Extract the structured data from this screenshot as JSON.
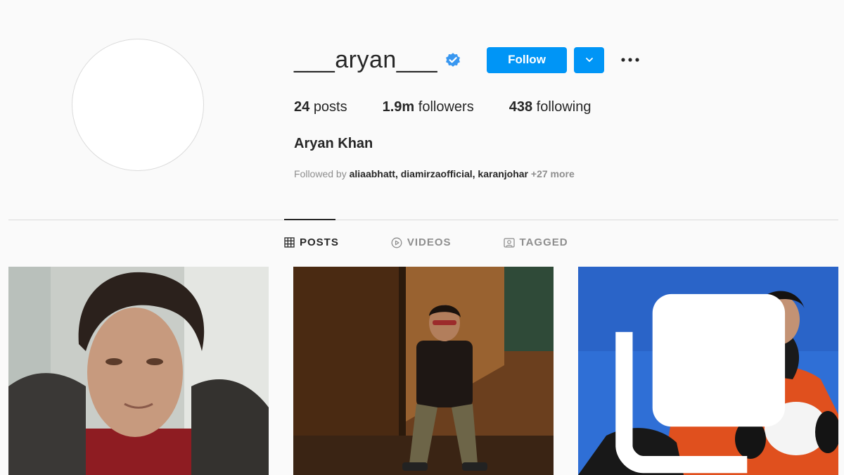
{
  "profile": {
    "username": "___aryan___",
    "verified": true,
    "follow_label": "Follow",
    "full_name": "Aryan Khan"
  },
  "stats": {
    "posts_count": "24",
    "posts_label": "posts",
    "followers_count": "1.9m",
    "followers_label": "followers",
    "following_count": "438",
    "following_label": "following"
  },
  "followed_by": {
    "prefix": "Followed by",
    "names": "aliaabhatt, diamirzaofficial, karanjohar",
    "more": "+27 more"
  },
  "tabs": [
    {
      "label": "POSTS",
      "icon": "grid-icon",
      "active": true
    },
    {
      "label": "VIDEOS",
      "icon": "play-circle-icon",
      "active": false
    },
    {
      "label": "TAGGED",
      "icon": "tagged-icon",
      "active": false
    }
  ],
  "posts": [
    {
      "description": "portrait-red-tshirt",
      "multi": false
    },
    {
      "description": "seated-in-sunlit-room",
      "multi": false
    },
    {
      "description": "snow-orange-jacket",
      "multi": true
    }
  ],
  "colors": {
    "accent": "#0095f6",
    "background": "#fafafa",
    "text": "#262626",
    "muted": "#8e8e8e",
    "divider": "#dbdbdb"
  }
}
